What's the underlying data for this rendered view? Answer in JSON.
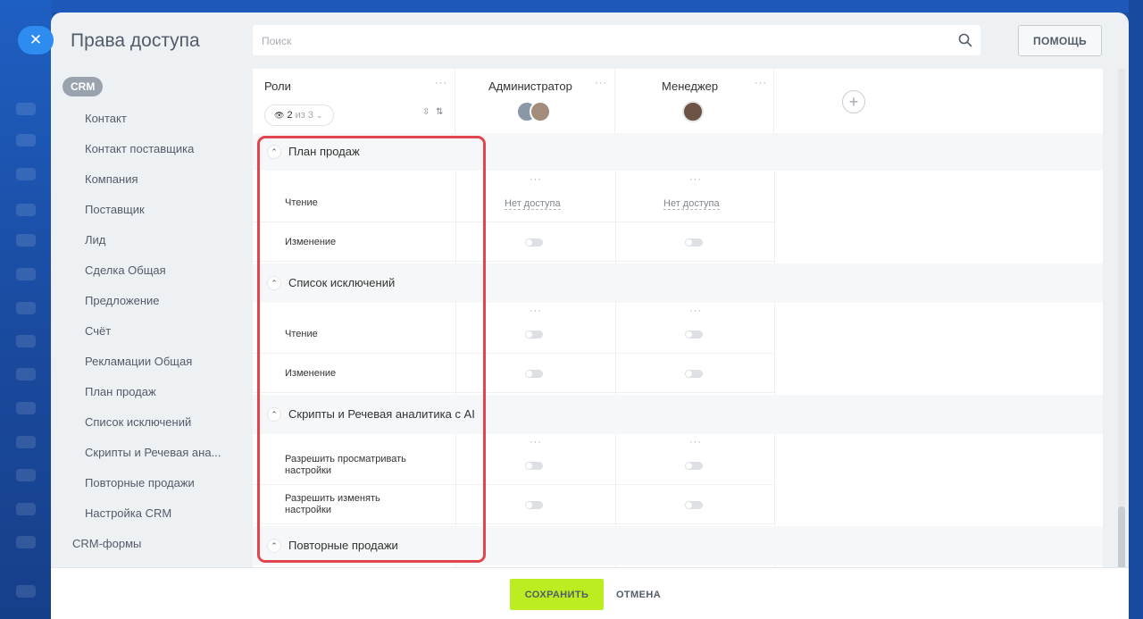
{
  "window": {
    "title": "Права доступа"
  },
  "search": {
    "placeholder": "Поиск"
  },
  "help_label": "ПОМОЩЬ",
  "sidebar": {
    "badge": "CRM",
    "items": [
      "Контакт",
      "Контакт поставщика",
      "Компания",
      "Поставщик",
      "Лид",
      "Сделка Общая",
      "Предложение",
      "Счёт",
      "Рекламации Общая",
      "План продаж",
      "Список исключений",
      "Скрипты и Речевая ана...",
      "Повторные продажи",
      "Настройка CRM"
    ],
    "top_items": [
      "CRM-формы"
    ]
  },
  "table": {
    "roles_header": "Роли",
    "roles_filter": {
      "count": "2",
      "of_text": "из 3"
    },
    "columns": [
      "Администратор",
      "Менеджер"
    ],
    "sections": [
      {
        "title": "План продаж",
        "rows": [
          {
            "label": "Чтение",
            "values": [
              "Нет доступа",
              "Нет доступа"
            ]
          },
          {
            "label": "Изменение",
            "values": [
              "toggle-off",
              "toggle-off"
            ]
          }
        ]
      },
      {
        "title": "Список исключений",
        "rows": [
          {
            "label": "Чтение",
            "values": [
              "toggle-off",
              "toggle-off"
            ]
          },
          {
            "label": "Изменение",
            "values": [
              "toggle-off",
              "toggle-off"
            ]
          }
        ]
      },
      {
        "title": "Скрипты и Речевая аналитика с AI",
        "rows": [
          {
            "label": "Разрешить просматривать настройки",
            "values": [
              "toggle-off",
              "toggle-off"
            ]
          },
          {
            "label": "Разрешить изменять настройки",
            "values": [
              "toggle-off",
              "toggle-off"
            ]
          }
        ]
      },
      {
        "title": "Повторные продажи",
        "rows": []
      }
    ]
  },
  "footer": {
    "save_label": "СОХРАНИТЬ",
    "cancel_label": "ОТМЕНА"
  },
  "colors": {
    "save_button": "#bbed21",
    "highlight_border": "#e2454d",
    "close_button": "#2e8cf0"
  }
}
